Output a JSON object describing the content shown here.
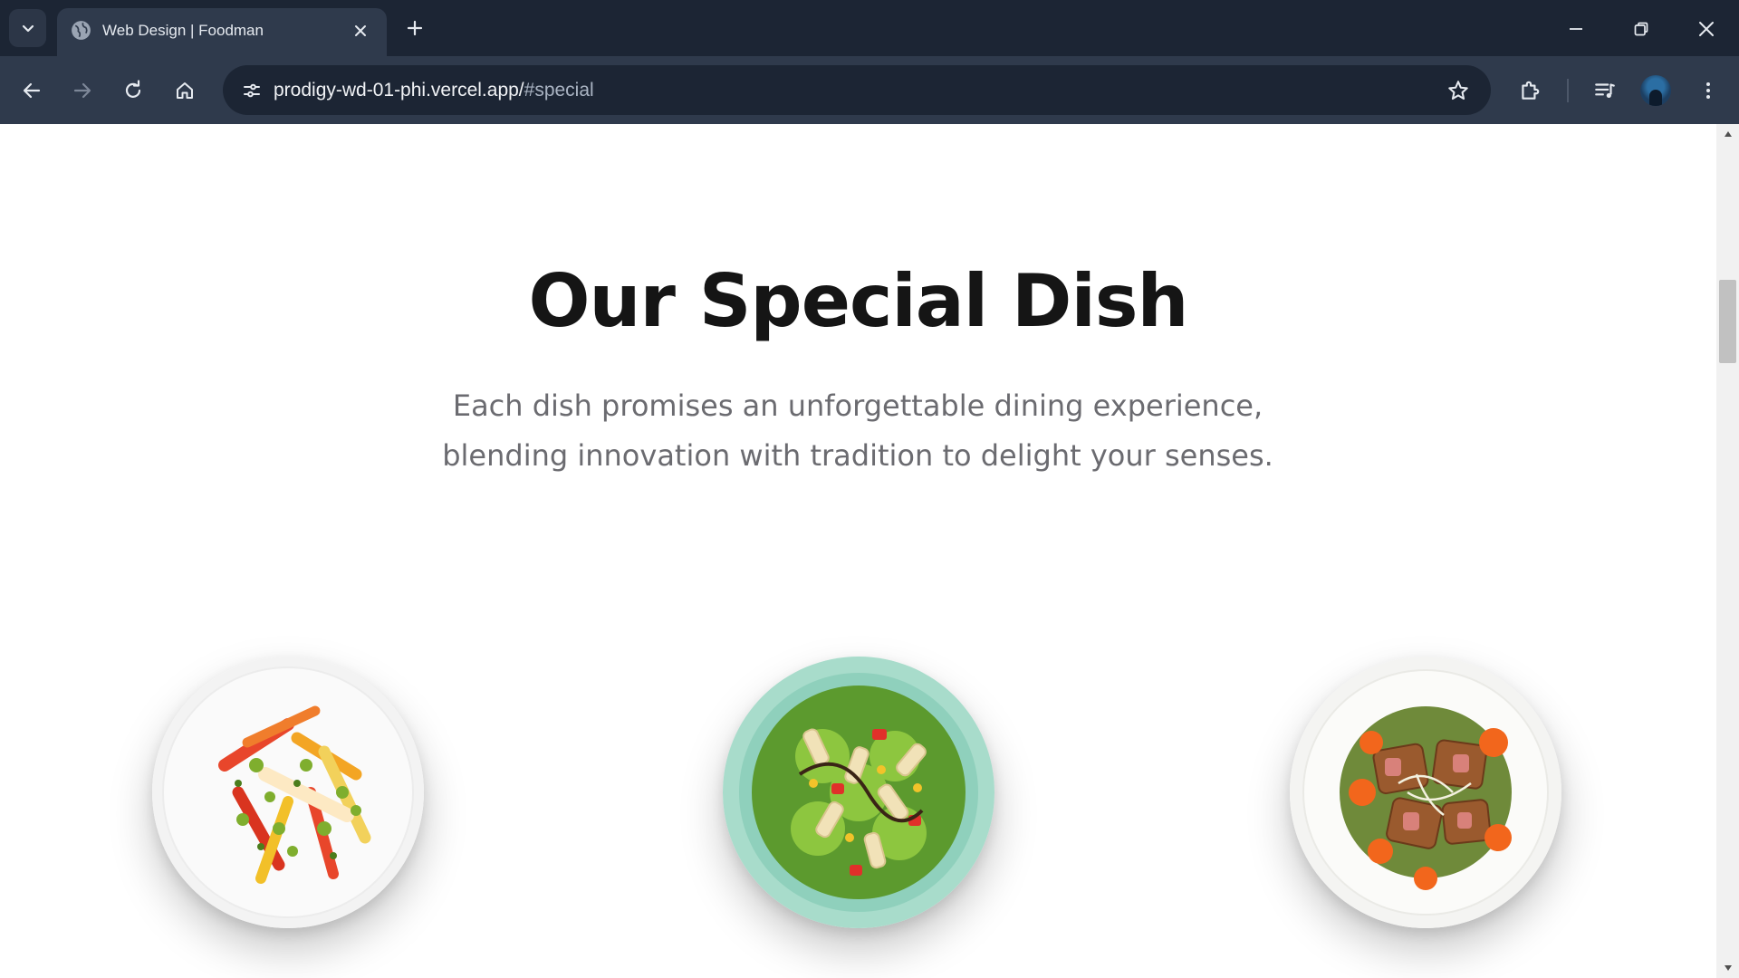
{
  "browser": {
    "tab": {
      "title": "Web Design | Foodman",
      "favicon": "globe-icon"
    },
    "address_bar": {
      "host": "prodigy-wd-01-phi.vercel.app/",
      "hash": "#special"
    },
    "icons": {
      "tab_search": "chevron-down-icon",
      "tab_close": "close-icon",
      "new_tab": "plus-icon",
      "minimize": "minimize-icon",
      "restore": "restore-icon",
      "close_window": "close-icon",
      "back": "arrow-left-icon",
      "forward": "arrow-right-icon",
      "reload": "reload-icon",
      "home": "home-icon",
      "site_info": "tune-icon",
      "bookmark": "star-icon",
      "extensions": "puzzle-icon",
      "media": "playlist-icon",
      "profile": "avatar",
      "menu": "kebab-menu-icon"
    },
    "colors": {
      "tabbar": "#1c2534",
      "toolbar": "#2f3a4c",
      "omnibox": "#1c2534"
    }
  },
  "page": {
    "section": {
      "heading": "Our Special Dish",
      "description_line1": "Each dish promises an unforgettable dining experience,",
      "description_line2": "blending innovation with tradition to delight your senses."
    },
    "dishes": [
      {
        "name": "vegetable-plate"
      },
      {
        "name": "pasta-salad-plate"
      },
      {
        "name": "grilled-tuna-salad-plate"
      }
    ],
    "colors": {
      "heading": "#151515",
      "description": "#6b6b70",
      "background": "#ffffff"
    }
  }
}
